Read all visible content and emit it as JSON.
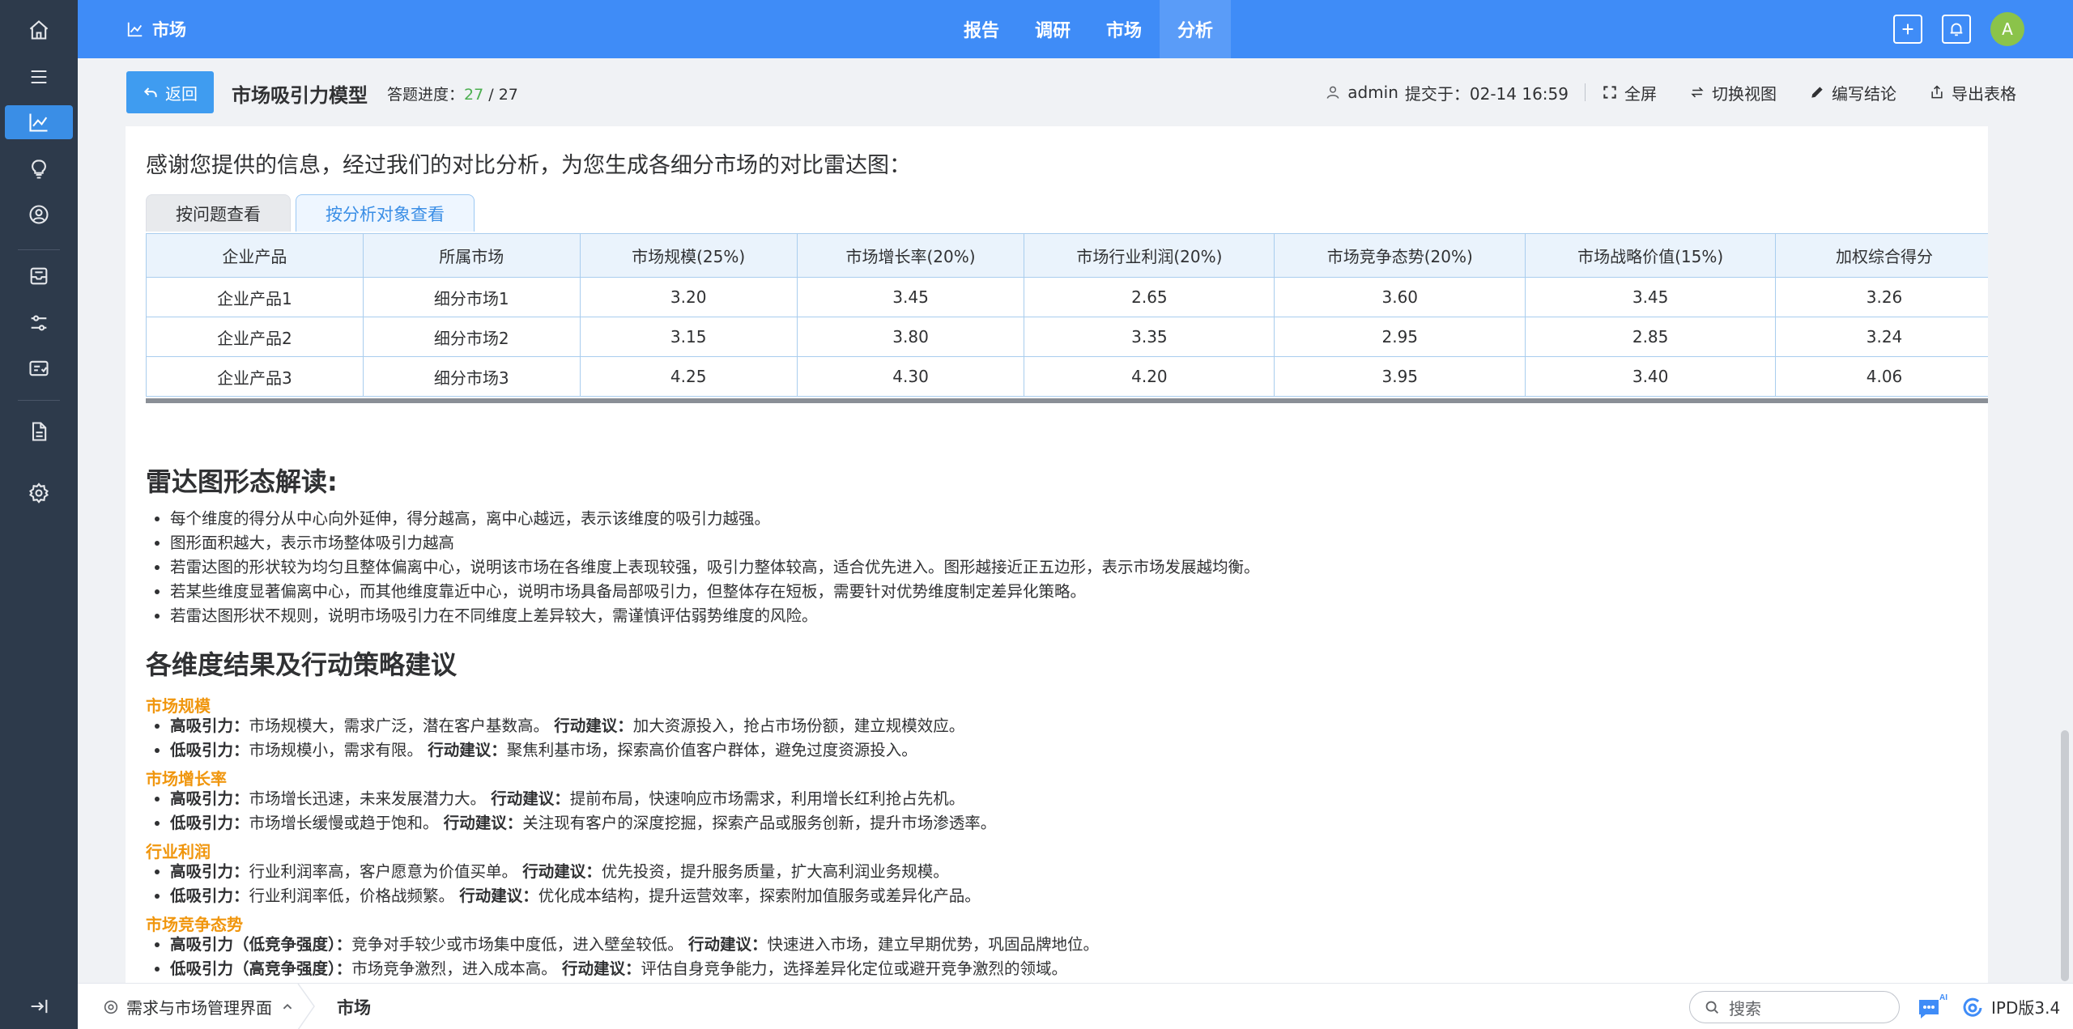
{
  "header": {
    "brand": "市场",
    "nav": [
      "报告",
      "调研",
      "市场",
      "分析"
    ],
    "active_nav": 3,
    "avatar_letter": "A"
  },
  "subbar": {
    "back_label": "返回",
    "title": "市场吸引力模型",
    "progress_label": "答题进度：",
    "progress_done": "27",
    "progress_sep": " / ",
    "progress_total": "27",
    "user": "admin",
    "submitted": "提交于：02-14 16:59",
    "fullscreen": "全屏",
    "switch_view": "切换视图",
    "write_conclusion": "编写结论",
    "export_table": "导出表格"
  },
  "content": {
    "intro": "感谢您提供的信息，经过我们的对比分析，为您生成各细分市场的对比雷达图：",
    "tabs": [
      "按问题查看",
      "按分析对象查看"
    ],
    "table": {
      "headers": [
        "企业产品",
        "所属市场",
        "市场规模(25%)",
        "市场增长率(20%)",
        "市场行业利润(20%)",
        "市场竞争态势(20%)",
        "市场战略价值(15%)",
        "加权综合得分"
      ],
      "rows": [
        [
          "企业产品1",
          "细分市场1",
          "3.20",
          "3.45",
          "2.65",
          "3.60",
          "3.45",
          "3.26"
        ],
        [
          "企业产品2",
          "细分市场2",
          "3.15",
          "3.80",
          "3.35",
          "2.95",
          "2.85",
          "3.24"
        ],
        [
          "企业产品3",
          "细分市场3",
          "4.25",
          "4.30",
          "4.20",
          "3.95",
          "3.40",
          "4.06"
        ]
      ]
    },
    "radar_title": "雷达图形态解读:",
    "radar_points": [
      "每个维度的得分从中心向外延伸，得分越高，离中心越远，表示该维度的吸引力越强。",
      "图形面积越大，表示市场整体吸引力越高",
      "若雷达图的形状较为均匀且整体偏离中心，说明该市场在各维度上表现较强，吸引力整体较高，适合优先进入。图形越接近正五边形，表示市场发展越均衡。",
      "若某些维度显著偏离中心，而其他维度靠近中心，说明市场具备局部吸引力，但整体存在短板，需要针对优势维度制定差异化策略。",
      "若雷达图形状不规则，说明市场吸引力在不同维度上差异较大，需谨慎评估弱势维度的风险。"
    ],
    "strategy_title": "各维度结果及行动策略建议",
    "dimensions": [
      {
        "name": "市场规模",
        "lines": [
          {
            "label": "高吸引力：",
            "text": "市场规模大，需求广泛，潜在客户基数高。",
            "action_label": "行动建议：",
            "action": "加大资源投入，抢占市场份额，建立规模效应。"
          },
          {
            "label": "低吸引力：",
            "text": "市场规模小，需求有限。",
            "action_label": "行动建议：",
            "action": "聚焦利基市场，探索高价值客户群体，避免过度资源投入。"
          }
        ]
      },
      {
        "name": "市场增长率",
        "lines": [
          {
            "label": "高吸引力：",
            "text": "市场增长迅速，未来发展潜力大。",
            "action_label": "行动建议：",
            "action": "提前布局，快速响应市场需求，利用增长红利抢占先机。"
          },
          {
            "label": "低吸引力：",
            "text": "市场增长缓慢或趋于饱和。",
            "action_label": "行动建议：",
            "action": "关注现有客户的深度挖掘，探索产品或服务创新，提升市场渗透率。"
          }
        ]
      },
      {
        "name": "行业利润",
        "lines": [
          {
            "label": "高吸引力：",
            "text": "行业利润率高，客户愿意为价值买单。",
            "action_label": "行动建议：",
            "action": "优先投资，提升服务质量，扩大高利润业务规模。"
          },
          {
            "label": "低吸引力：",
            "text": "行业利润率低，价格战频繁。",
            "action_label": "行动建议：",
            "action": "优化成本结构，提升运营效率，探索附加值服务或差异化产品。"
          }
        ]
      },
      {
        "name": "市场竞争态势",
        "lines": [
          {
            "label": "高吸引力（低竞争强度）：",
            "text": "竞争对手较少或市场集中度低，进入壁垒较低。",
            "action_label": "行动建议：",
            "action": "快速进入市场，建立早期优势，巩固品牌地位。"
          },
          {
            "label": "低吸引力（高竞争强度）：",
            "text": "市场竞争激烈，进入成本高。",
            "action_label": "行动建议：",
            "action": "评估自身竞争能力，选择差异化定位或避开竞争激烈的领域。"
          }
        ]
      }
    ]
  },
  "bottom": {
    "module": "需求与市场管理界面",
    "tab": "市场",
    "search_placeholder": "搜索",
    "ai_badge": "AI",
    "version": "IPD版3.4"
  },
  "colors": {
    "primary": "#3f8cf7",
    "sidebar": "#2d3a4b",
    "accent_orange": "#f0960e",
    "progress_green": "#4caf50"
  }
}
